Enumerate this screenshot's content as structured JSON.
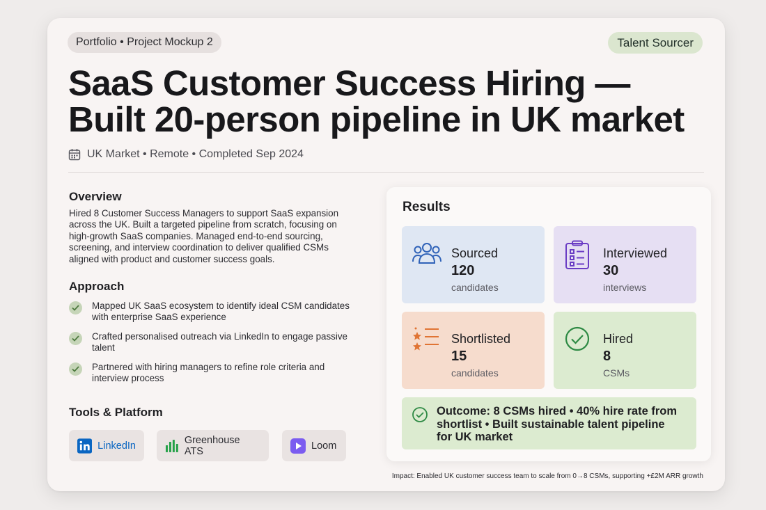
{
  "header": {
    "breadcrumb": "Portfolio • Project Mockup 2",
    "role_badge": "Talent Sourcer",
    "title": "SaaS Customer Success Hiring — Built 20-person pipeline in UK market",
    "meta": "UK Market • Remote • Completed Sep 2024"
  },
  "overview": {
    "heading": "Overview",
    "text": "Hired 8 Customer Success Managers to support SaaS expansion across the UK. Built a targeted pipeline from scratch, focusing on high-growth SaaS companies. Managed end-to-end sourcing, screening, and interview coordination to deliver qualified CSMs aligned with product and customer success goals."
  },
  "approach": {
    "heading": "Approach",
    "items": [
      "Mapped UK SaaS ecosystem to identify ideal CSM candidates with enterprise SaaS experience",
      "Crafted personalised outreach via LinkedIn to engage passive talent",
      "Partnered with hiring managers to refine role criteria and interview process"
    ]
  },
  "tools": {
    "heading": "Tools & Platform",
    "items": [
      "LinkedIn",
      "Greenhouse ATS",
      "Loom"
    ]
  },
  "results": {
    "heading": "Results",
    "stats": [
      {
        "label": "Sourced",
        "value": "120",
        "unit": "candidates",
        "icon": "people-icon",
        "color": "#dfe7f3"
      },
      {
        "label": "Interviewed",
        "value": "30",
        "unit": "interviews",
        "icon": "clipboard-list-icon",
        "color": "#e6dff3"
      },
      {
        "label": "Shortlisted",
        "value": "15",
        "unit": "candidates",
        "icon": "star-list-icon",
        "color": "#f6dccd"
      },
      {
        "label": "Hired",
        "value": "8",
        "unit": "CSMs",
        "icon": "check-circle-icon",
        "color": "#dcebd0"
      }
    ],
    "outcome": "Outcome: 8 CSMs hired • 40% hire rate from shortlist • Built sustainable talent pipeline for UK market"
  },
  "impact": "Impact: Enabled UK customer success team to scale from 0→8 CSMs, supporting +£2M ARR growth",
  "colors": {
    "background": "#efeceb",
    "card": "#f8f4f3",
    "linkedin": "#0a66c2",
    "greenhouse": "#24a148",
    "loom": "#625df5",
    "check": "#2e9e4f"
  }
}
